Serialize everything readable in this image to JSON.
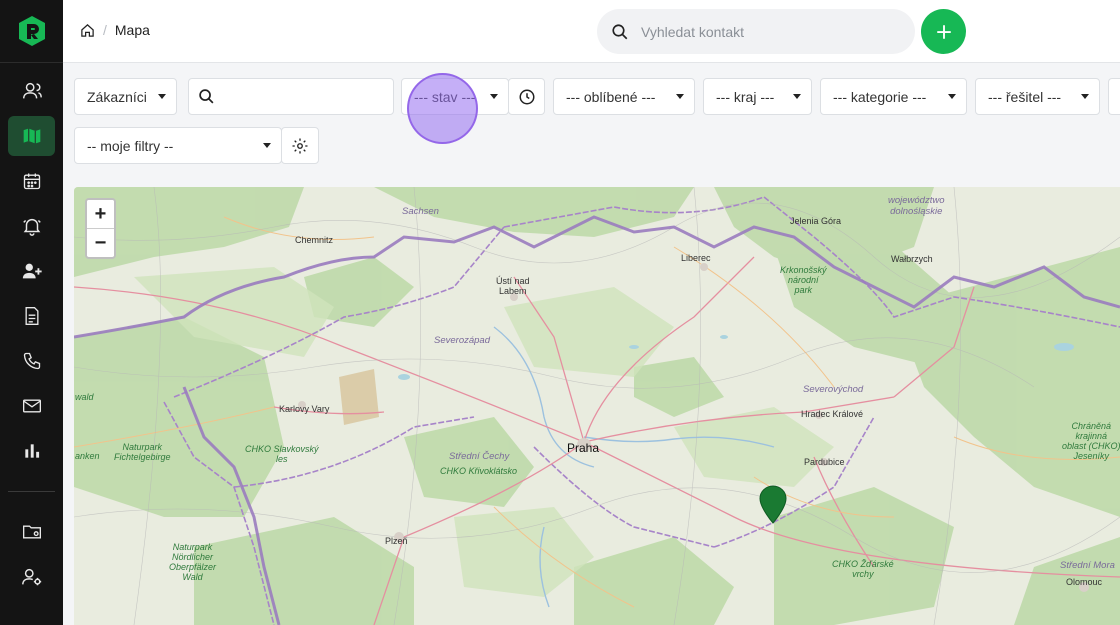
{
  "breadcrumb": {
    "current": "Mapa"
  },
  "search": {
    "placeholder": "Vyhledat kontakt"
  },
  "colors": {
    "accent": "#17b855",
    "sidebar": "#141414",
    "active_nav": "#1f4d31",
    "pin": "#1a7a32"
  },
  "sidebar": {
    "items": [
      {
        "icon": "users-icon"
      },
      {
        "icon": "map-icon",
        "active": true
      },
      {
        "icon": "calendar-icon"
      },
      {
        "icon": "bell-icon"
      },
      {
        "icon": "user-add-icon"
      },
      {
        "icon": "document-icon"
      },
      {
        "icon": "phone-icon"
      },
      {
        "icon": "mail-icon"
      },
      {
        "icon": "chart-icon"
      },
      {
        "icon": "folder-settings-icon"
      },
      {
        "icon": "user-settings-icon"
      }
    ]
  },
  "filters": {
    "type": "Zákazníci",
    "stav": "--- stav ---",
    "oblibene": "--- oblíbené ---",
    "kraj": "--- kraj ---",
    "kategorie": "--- kategorie ---",
    "resitel": "--- řešitel ---",
    "moje_filtry": "-- moje filtry --"
  },
  "map": {
    "zoom_in": "+",
    "zoom_out": "−",
    "labels": {
      "sachsen": "Sachsen",
      "chemnitz": "Chemnitz",
      "usti": "Ústí nad\nLabem",
      "liberec": "Liberec",
      "jelenia": "Jelenia Góra",
      "walbrzych": "Wałbrzych",
      "wojewodztwo": "województwo\ndolnośląskie",
      "krkonossky": "Krkonošský\nnárodní\npark",
      "severozapad": "Severozápad",
      "severovychod": "Severovýchod",
      "karlovy": "Karlovy Vary",
      "hradec": "Hradec Králové",
      "praha": "Praha",
      "pardubice": "Pardubice",
      "naturpark_fichtel": "Naturpark\nFichtelgebirge",
      "chko_slavkovsky": "CHKO Slavkovský\nles",
      "stredni_cechy": "Střední Čechy",
      "chko_krivoklatsko": "CHKO Křivoklátsko",
      "plzen": "Plzeň",
      "naturpark_nordlicher": "Naturpark\nNördlicher\nOberpfälzer\nWald",
      "chko_zdarske": "CHKO Žďárské\nvrchy",
      "chranena": "Chráněná\nkrajinná\noblast (CHKO)\nJeseníky",
      "olomouc": "Olomouc",
      "stredni_morava": "Střední Mora",
      "wald": "wald",
      "anken": "anken"
    }
  }
}
